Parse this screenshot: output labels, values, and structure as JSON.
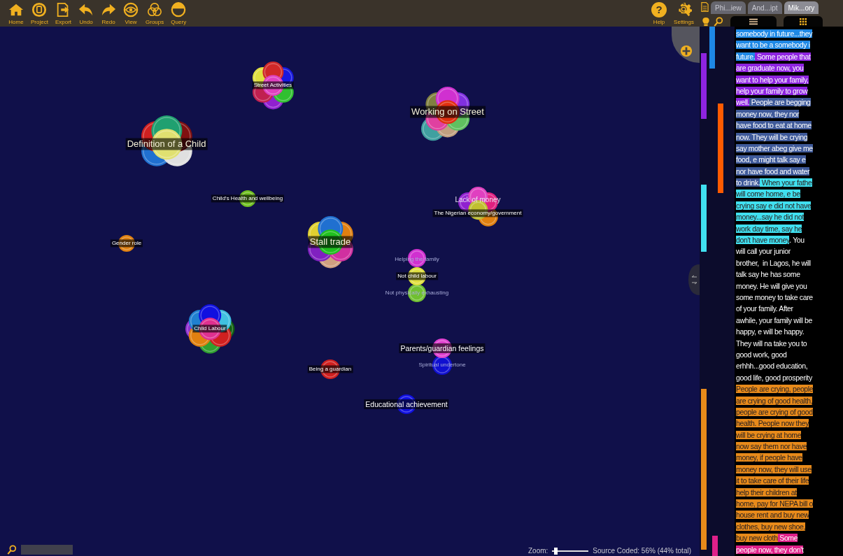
{
  "toolbar": {
    "left": [
      {
        "label": "Home"
      },
      {
        "label": "Project"
      },
      {
        "label": "Export"
      },
      {
        "label": "Undo"
      },
      {
        "label": "Redo"
      },
      {
        "label": "View"
      },
      {
        "label": "Groups"
      },
      {
        "label": "Query"
      }
    ],
    "right": [
      {
        "label": "Help",
        "glyph": "?"
      },
      {
        "label": "Settings"
      }
    ]
  },
  "tabs": [
    {
      "label": "Phi...iew",
      "selected": false
    },
    {
      "label": "And...ipt",
      "selected": false
    },
    {
      "label": "Mik...ory",
      "selected": true
    }
  ],
  "nodes": [
    {
      "labels": [
        {
          "text": "Street Activities",
          "kind": "boxed"
        }
      ],
      "circles": [
        {
          "color": "#e040c0"
        },
        {
          "color": "#d02828"
        },
        {
          "color": "#1818e0"
        },
        {
          "color": "#e0e040"
        },
        {
          "color": "#30c030"
        },
        {
          "color": "#c02050"
        },
        {
          "color": "#9020d0"
        }
      ]
    },
    {
      "labels": [
        {
          "text": "Working on Street",
          "kind": "boxed-large"
        }
      ],
      "circles": [
        {
          "color": "#e03010"
        },
        {
          "color": "#d030d0"
        },
        {
          "color": "#8030e0"
        },
        {
          "color": "#808040"
        },
        {
          "color": "#60c060"
        },
        {
          "color": "#e040a0"
        },
        {
          "color": "#c0a080"
        },
        {
          "color": "#40a0a0"
        }
      ]
    },
    {
      "labels": [
        {
          "text": "Definition of a Child",
          "kind": "boxed-large"
        }
      ],
      "circles": [
        {
          "color": "#e0e070"
        },
        {
          "color": "#20a070"
        },
        {
          "color": "#801010"
        },
        {
          "color": "#d02020"
        },
        {
          "color": "#e0e0e0"
        },
        {
          "color": "#2070d0"
        }
      ]
    },
    {
      "labels": [
        {
          "text": "Child's Health and wellbeing",
          "kind": "boxed"
        }
      ],
      "circles": [
        {
          "color": "#70c020"
        }
      ]
    },
    {
      "labels": [
        {
          "text": "Gender role",
          "kind": "boxed"
        }
      ],
      "circles": [
        {
          "color": "#e08010"
        }
      ]
    },
    {
      "labels": [
        {
          "text": "Stall trade",
          "kind": "boxed-large"
        }
      ],
      "circles": [
        {
          "color": "#20c020"
        },
        {
          "color": "#2070d0"
        },
        {
          "color": "#e08010"
        },
        {
          "color": "#e0d030"
        },
        {
          "color": "#d030a0"
        },
        {
          "color": "#8020c0"
        },
        {
          "color": "#d0a080"
        }
      ]
    },
    {
      "labels": [
        {
          "text": "Lack of money",
          "kind": "plain"
        },
        {
          "text": "The Nigerian economy/government",
          "kind": "boxed"
        }
      ],
      "circles": [
        {
          "color": "#c0c030"
        },
        {
          "color": "#e040c0"
        },
        {
          "color": "#e02080"
        },
        {
          "color": "#9020d0"
        },
        {
          "color": "#e08010"
        }
      ]
    },
    {
      "labels": [
        {
          "text": "Helping the family",
          "kind": "faint"
        },
        {
          "text": "Not child labour",
          "kind": "boxed"
        },
        {
          "text": "Not physically exhausting",
          "kind": "faint"
        }
      ],
      "circles": [
        {
          "color": "#e0e040"
        },
        {
          "color": "#d030d0"
        },
        {
          "color": "#70c030"
        }
      ]
    },
    {
      "labels": [
        {
          "text": "Child Labour",
          "kind": "boxed"
        }
      ],
      "circles": [
        {
          "color": "#e03090"
        },
        {
          "color": "#1010e0"
        },
        {
          "color": "#40c0e0"
        },
        {
          "color": "#2080d0"
        },
        {
          "color": "#d02020"
        },
        {
          "color": "#e08010"
        },
        {
          "color": "#30a030"
        },
        {
          "color": "#106010"
        },
        {
          "color": "#9030d0"
        }
      ]
    },
    {
      "labels": [
        {
          "text": "Parents/guardian feelings",
          "kind": "boxed-medium"
        },
        {
          "text": "Spiritual undertone",
          "kind": "faint"
        }
      ],
      "circles": [
        {
          "color": "#e040d0"
        },
        {
          "color": "#1010d0"
        }
      ]
    },
    {
      "labels": [
        {
          "text": "Being a guardian",
          "kind": "boxed"
        }
      ],
      "circles": [
        {
          "color": "#d02020"
        }
      ]
    },
    {
      "labels": [
        {
          "text": "Educational achievement",
          "kind": "boxed-medium"
        }
      ],
      "circles": [
        {
          "color": "#1010e0"
        }
      ]
    }
  ],
  "zoom": {
    "label": "Zoom:",
    "level": 0.05
  },
  "status": "Source Coded: 56% (44% total)",
  "coding_stripes": [
    {
      "color": "#1e88e5"
    },
    {
      "color": "#8e24e0"
    },
    {
      "color": "#ff5a00"
    },
    {
      "color": "#40e0f0"
    },
    {
      "color": "#e88a1a"
    },
    {
      "color": "#e0208a"
    }
  ],
  "transcript": [
    {
      "parts": [
        {
          "text": "somebody in future...they",
          "color": "#1e88e5"
        }
      ]
    },
    {
      "parts": [
        {
          "text": "want to be a somebody i",
          "color": "#1e88e5"
        }
      ]
    },
    {
      "parts": [
        {
          "text": "future.",
          "color": "#1e88e5"
        },
        {
          "text": " Some people that",
          "color": "#8e24e0"
        }
      ]
    },
    {
      "parts": [
        {
          "text": "are graduate now, you",
          "color": "#8e24e0"
        }
      ]
    },
    {
      "parts": [
        {
          "text": "want to help your family,",
          "color": "#8e24e0"
        }
      ]
    },
    {
      "parts": [
        {
          "text": "help your family to grow",
          "color": "#8e24e0"
        }
      ]
    },
    {
      "parts": [
        {
          "text": "well.",
          "color": "#8e24e0"
        },
        {
          "text": " People are begging",
          "color": "#3f5a9a"
        }
      ]
    },
    {
      "parts": [
        {
          "text": "money now, they nor",
          "color": "#3f5a9a"
        }
      ]
    },
    {
      "parts": [
        {
          "text": "have food to eat at home",
          "color": "#3f5a9a"
        }
      ]
    },
    {
      "parts": [
        {
          "text": "now. They will be crying",
          "color": "#3f5a9a"
        }
      ]
    },
    {
      "parts": [
        {
          "text": "say mother abeg give me",
          "color": "#3f5a9a"
        }
      ]
    },
    {
      "parts": [
        {
          "text": "food, e might talk say e",
          "color": "#3f5a9a"
        }
      ]
    },
    {
      "parts": [
        {
          "text": "nor have food and water",
          "color": "#3f5a9a"
        }
      ]
    },
    {
      "parts": [
        {
          "text": "to drink.",
          "color": "#3f5a9a"
        },
        {
          "text": " When your fathe",
          "color": "#40e0f0"
        }
      ]
    },
    {
      "parts": [
        {
          "text": "will come home, e be",
          "color": "#40e0f0"
        }
      ]
    },
    {
      "parts": [
        {
          "text": "crying say e did not have",
          "color": "#40e0f0"
        }
      ]
    },
    {
      "parts": [
        {
          "text": "money...say he did not",
          "color": "#40e0f0"
        }
      ]
    },
    {
      "parts": [
        {
          "text": "work day time, say he",
          "color": "#40e0f0"
        }
      ]
    },
    {
      "parts": [
        {
          "text": "don't have money",
          "color": "#40e0f0"
        },
        {
          "text": ". You"
        }
      ]
    },
    {
      "parts": [
        {
          "text": "will call your junior"
        }
      ]
    },
    {
      "parts": [
        {
          "text": "brother,  in Lagos, he will"
        }
      ]
    },
    {
      "parts": [
        {
          "text": "talk say he has some"
        }
      ]
    },
    {
      "parts": [
        {
          "text": "money. He will give you"
        }
      ]
    },
    {
      "parts": [
        {
          "text": "some money to take care"
        }
      ]
    },
    {
      "parts": [
        {
          "text": "of your family. After"
        }
      ]
    },
    {
      "parts": [
        {
          "text": "awhile, your family will be"
        }
      ]
    },
    {
      "parts": [
        {
          "text": "happy, e will be happy."
        }
      ]
    },
    {
      "parts": [
        {
          "text": "They will na take you to"
        }
      ]
    },
    {
      "parts": [
        {
          "text": "good work, good"
        }
      ]
    },
    {
      "parts": [
        {
          "text": "erhhh...good education,"
        }
      ]
    },
    {
      "parts": [
        {
          "text": "good life, good prosperity"
        }
      ]
    },
    {
      "parts": [
        {
          "text": "People are crying, people",
          "color": "#e88a1a"
        }
      ]
    },
    {
      "parts": [
        {
          "text": "are crying of good health,",
          "color": "#e88a1a"
        }
      ]
    },
    {
      "parts": [
        {
          "text": "people are crying of good",
          "color": "#e88a1a"
        }
      ]
    },
    {
      "parts": [
        {
          "text": "health. People now they",
          "color": "#e88a1a"
        }
      ]
    },
    {
      "parts": [
        {
          "text": "will be crying at home",
          "color": "#e88a1a"
        }
      ]
    },
    {
      "parts": [
        {
          "text": "now say them nor have",
          "color": "#e88a1a"
        }
      ]
    },
    {
      "parts": [
        {
          "text": "money, if people have",
          "color": "#e88a1a"
        }
      ]
    },
    {
      "parts": [
        {
          "text": "money now, they will use",
          "color": "#e88a1a"
        }
      ]
    },
    {
      "parts": [
        {
          "text": "it to take care of their life",
          "color": "#e88a1a"
        }
      ]
    },
    {
      "parts": [
        {
          "text": "help their children at",
          "color": "#e88a1a"
        }
      ]
    },
    {
      "parts": [
        {
          "text": "home, pay for NEPA bill o",
          "color": "#e88a1a"
        }
      ]
    },
    {
      "parts": [
        {
          "text": "house rent and buy new",
          "color": "#e88a1a"
        }
      ]
    },
    {
      "parts": [
        {
          "text": "clothes, buy new shoe,",
          "color": "#e88a1a"
        }
      ]
    },
    {
      "parts": [
        {
          "text": "buy new cloth",
          "color": "#e88a1a"
        },
        {
          "text": " Some",
          "color": "#e0208a"
        }
      ]
    },
    {
      "parts": [
        {
          "text": "people now, they don't",
          "color": "#e0208a"
        }
      ]
    }
  ]
}
